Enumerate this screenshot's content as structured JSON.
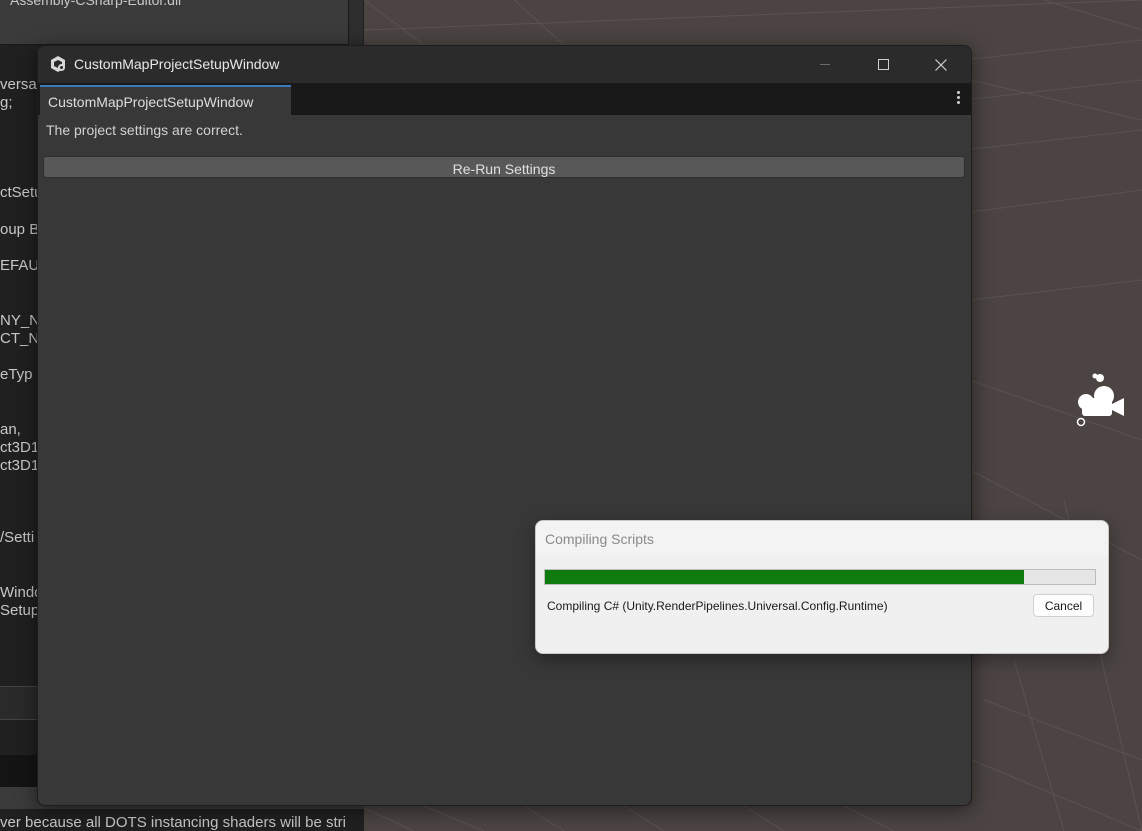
{
  "background_editor": {
    "file_label": "Assembly-CSharp-Editor.dll",
    "code_fragments": [
      {
        "text": "versa",
        "line": 1
      },
      {
        "text": "g;",
        "line": 2
      },
      {
        "text": "ctSetu",
        "line": 3
      },
      {
        "text": "oup Bi",
        "line": 4
      },
      {
        "text": "EFAUL",
        "line": 5
      },
      {
        "text": "NY_NA",
        "line": 6
      },
      {
        "text": "CT_NA",
        "line": 7
      },
      {
        "text": "eTyp",
        "line": 8
      },
      {
        "text": "an,",
        "line": 9
      },
      {
        "text": "ct3D1",
        "line": 10
      },
      {
        "text": "ct3D1",
        "line": 11
      },
      {
        "text": "/Setti",
        "line": 12
      },
      {
        "text": "Windo",
        "line": 13
      },
      {
        "text": "Setup",
        "line": 14
      }
    ],
    "bottom_text": "ver because all DOTS instancing shaders will be stri"
  },
  "window": {
    "title": "CustomMapProjectSetupWindow",
    "tab_label": "CustomMapProjectSetupWindow",
    "status_message": "The project settings are correct.",
    "rerun_button_label": "Re-Run Settings"
  },
  "progress_dialog": {
    "title": "Compiling Scripts",
    "progress": 0.87,
    "message": "Compiling C# (Unity.RenderPipelines.Universal.Config.Runtime)",
    "cancel_label": "Cancel"
  },
  "colors": {
    "progress_fill": "#0f7b0f",
    "tab_accent": "#3a79bb"
  }
}
